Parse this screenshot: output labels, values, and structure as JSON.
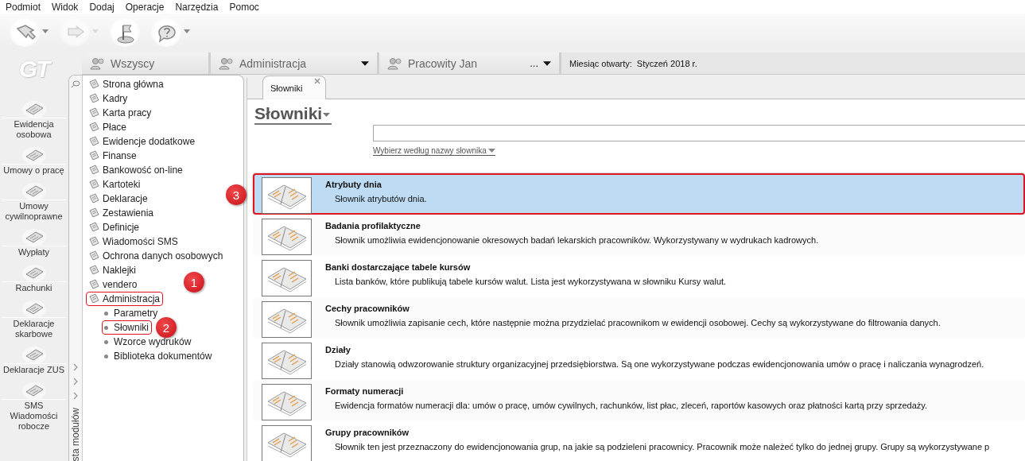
{
  "menu_bar": [
    "Podmiot",
    "Widok",
    "Dodaj",
    "Operacje",
    "Narzędzia",
    "Pomoc"
  ],
  "toolbar": [
    {
      "kind": "back",
      "dropdown": true,
      "disabled": false
    },
    {
      "kind": "forward",
      "dropdown": true,
      "disabled": true
    },
    {
      "kind": "flag",
      "dropdown": false,
      "disabled": false
    },
    {
      "kind": "help",
      "dropdown": true,
      "disabled": false
    }
  ],
  "logo": "GT",
  "modules": [
    "Ewidencja osobowa",
    "Umowy o pracę",
    "Umowy cywilnoprawne",
    "Wypłaty",
    "Rachunki",
    "Deklaracje skarbowe",
    "Deklaracje ZUS",
    "SMS Wiadomości robocze"
  ],
  "context_bar": {
    "tabs": [
      {
        "label": "Wszyscy",
        "dropdown": false
      },
      {
        "label": "Administracja",
        "dropdown": true
      },
      {
        "label": "Pracowity Jan",
        "dropdown": true,
        "more": "..."
      }
    ],
    "month_label": "Miesiąc otwarty:",
    "month_value": "Styczeń 2018 r."
  },
  "nav_panel": {
    "vertical_label": "sta modułów",
    "items": [
      {
        "label": "Strona główna",
        "annotated": false
      },
      {
        "label": "Kadry",
        "annotated": false
      },
      {
        "label": "Karta pracy",
        "annotated": false
      },
      {
        "label": "Płace",
        "annotated": false
      },
      {
        "label": "Ewidencje dodatkowe",
        "annotated": false
      },
      {
        "label": "Finanse",
        "annotated": false
      },
      {
        "label": "Bankowość on-line",
        "annotated": false
      },
      {
        "label": "Kartoteki",
        "annotated": false
      },
      {
        "label": "Deklaracje",
        "annotated": false
      },
      {
        "label": "Zestawienia",
        "annotated": false
      },
      {
        "label": "Definicje",
        "annotated": false
      },
      {
        "label": "Wiadomości SMS",
        "annotated": false
      },
      {
        "label": "Ochrona danych osobowych",
        "annotated": false
      },
      {
        "label": "Naklejki",
        "annotated": false
      },
      {
        "label": "vendero",
        "annotated": false
      },
      {
        "label": "Administracja",
        "annotated": true,
        "marker": "1",
        "children": [
          {
            "label": "Parametry",
            "annotated": false
          },
          {
            "label": "Słowniki",
            "annotated": true,
            "marker": "2"
          },
          {
            "label": "Wzorce wydruków",
            "annotated": false
          },
          {
            "label": "Biblioteka dokumentów",
            "annotated": false
          }
        ]
      }
    ]
  },
  "document_tabs": [
    {
      "label": "Słowniki",
      "selected": true
    }
  ],
  "heading": "Słowniki",
  "filter_link": "Wybierz według nazwy słownika",
  "dictionaries": [
    {
      "title": "Atrybuty dnia",
      "description": "Słownik atrybutów dnia.",
      "selected": true,
      "annotated": true,
      "marker": "3"
    },
    {
      "title": "Badania profilaktyczne",
      "description": "Słownik umożliwia ewidencjonowanie okresowych badań lekarskich pracowników. Wykorzystywany w wydrukach kadrowych.",
      "selected": false,
      "annotated": false
    },
    {
      "title": "Banki dostarczające tabele kursów",
      "description": "Lista banków, które publikują tabele kursów walut. Lista jest wykorzystywana w słowniku Kursy walut.",
      "selected": false,
      "annotated": false
    },
    {
      "title": "Cechy pracowników",
      "description": "Słownik umożliwia zapisanie cech, które następnie można przydzielać pracownikom w ewidencji osobowej. Cechy są wykorzystywane do filtrowania danych.",
      "selected": false,
      "annotated": false
    },
    {
      "title": "Działy",
      "description": "Działy stanowią odwzorowanie struktury organizacyjnej przedsiębiorstwa. Są one wykorzystywane podczas ewidencjonowania umów o pracę i naliczania wynagrodzeń.",
      "selected": false,
      "annotated": false
    },
    {
      "title": "Formaty numeracji",
      "description": "Ewidencja formatów numeracji dla: umów o pracę, umów cywilnych, rachunków, list płac, zleceń, raportów kasowych oraz płatności kartą przy sprzedaży.",
      "selected": false,
      "annotated": false
    },
    {
      "title": "Grupy pracowników",
      "description": "Słownik ten jest przeznaczony do ewidencjonowania grup, na jakie są podzieleni pracownicy. Pracownik może należeć tylko do jednej grupy. Grupy są wykorzystywane p",
      "selected": false,
      "annotated": false
    }
  ]
}
